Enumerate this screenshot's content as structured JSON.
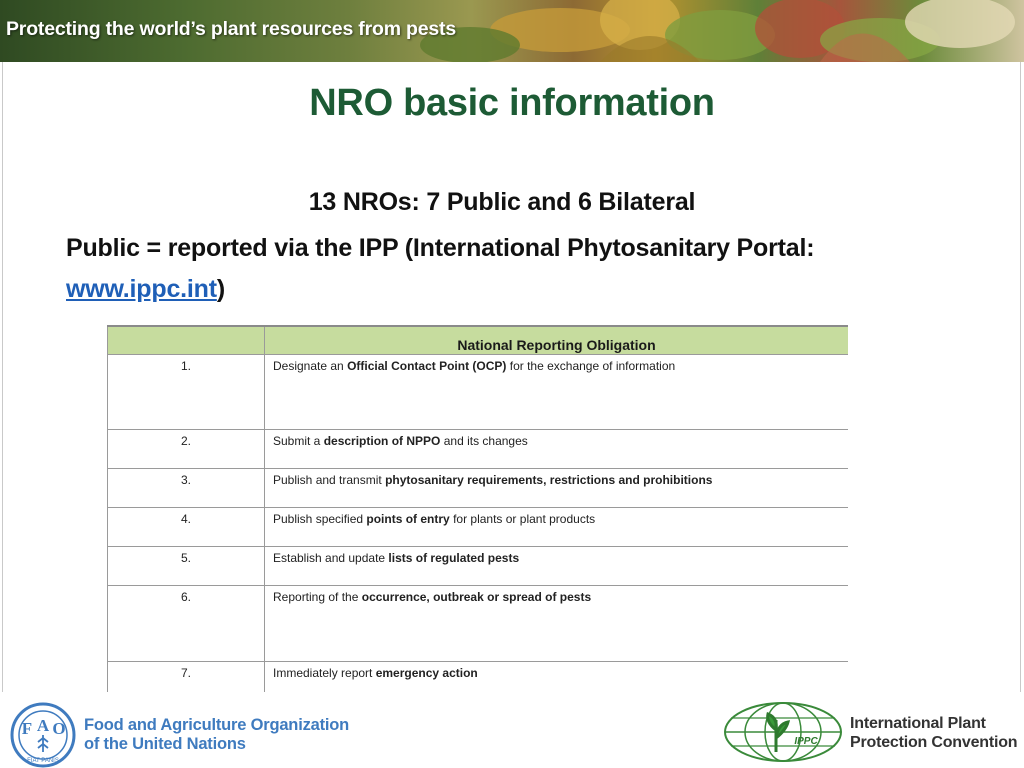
{
  "banner": {
    "title": "Protecting the world’s plant resources from pests"
  },
  "slide": {
    "title": "NRO basic information",
    "subtitle": "13 NROs: 7 Public and 6 Bilateral",
    "para_prefix": "Public = reported via the IPP (International Phytosanitary Portal: ",
    "link": "www.ippc.int",
    "para_suffix": ")"
  },
  "table": {
    "header": "National Reporting Obligation",
    "rows": [
      {
        "num": "1.",
        "pre": "Designate an ",
        "bold": "Official Contact Point (OCP)",
        "post": " for the exchange of information"
      },
      {
        "num": "2.",
        "pre": "Submit a ",
        "bold": "description of NPPO",
        "post": " and its changes"
      },
      {
        "num": "3.",
        "pre": "Publish and transmit ",
        "bold": "phytosanitary requirements, restrictions and prohibitions",
        "post": ""
      },
      {
        "num": "4.",
        "pre": "Publish specified ",
        "bold": "points of entry",
        "post": " for plants or plant products"
      },
      {
        "num": "5.",
        "pre": "Establish and update ",
        "bold": "lists of regulated pests",
        "post": ""
      },
      {
        "num": "6.",
        "pre": "Reporting of the ",
        "bold": "occurrence, outbreak or spread of pests",
        "post": ""
      },
      {
        "num": "7.",
        "pre": "Immediately report ",
        "bold": "emergency action",
        "post": ""
      }
    ]
  },
  "footer": {
    "fao_line1": "Food and Agriculture Organization",
    "fao_line2": "of the United Nations",
    "ippc_line1": "International Plant",
    "ippc_line2": "Protection Convention",
    "ippc_badge": "IPPC",
    "fao_letters": [
      "F",
      "A",
      "O"
    ],
    "fao_motto": "FIAT PANIS"
  },
  "colors": {
    "title_green": "#1d5b35",
    "link_blue": "#1f5fb7",
    "table_header_green": "#c6dc9e",
    "fao_blue": "#3f7bbf"
  }
}
